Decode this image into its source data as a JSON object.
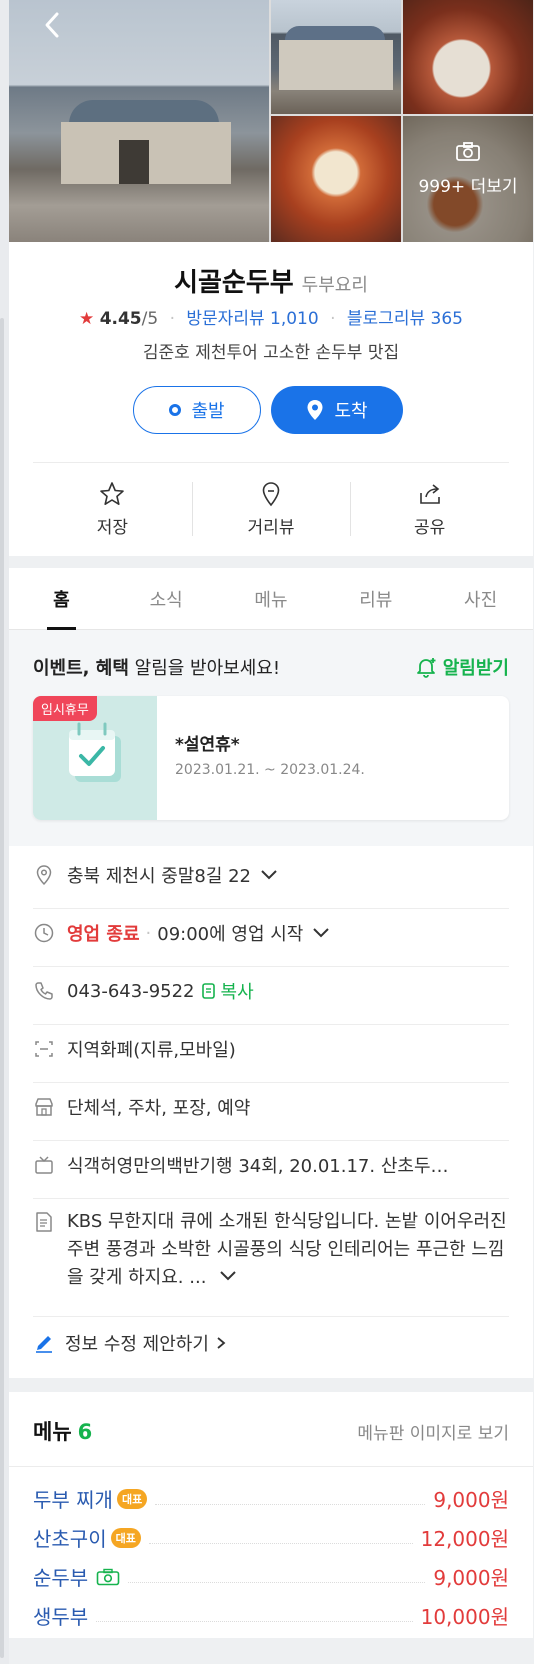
{
  "photos": {
    "more_label": "999+ 더보기",
    "sign_text": "시골순두부"
  },
  "place": {
    "name": "시골순두부",
    "category": "두부요리",
    "rating": "4.45",
    "rating_max": "/5",
    "visitor_review_label": "방문자리뷰 1,010",
    "blog_review_label": "블로그리뷰 365",
    "description": "김준호 제천투어 고소한 손두부 맛집"
  },
  "route": {
    "depart_label": "출발",
    "arrive_label": "도착"
  },
  "actions": {
    "save": "저장",
    "street_view": "거리뷰",
    "share": "공유"
  },
  "tabs": [
    "홈",
    "소식",
    "메뉴",
    "리뷰",
    "사진"
  ],
  "notice": {
    "bold": "이벤트, 혜택",
    "text": " 알림을 받아보세요!",
    "button": "알림받기",
    "event": {
      "badge": "임시휴무",
      "title": "*설연휴*",
      "date": "2023.01.21. ~ 2023.01.24."
    }
  },
  "info": {
    "address": "충북 제천시 중말8길 22",
    "status": "영업 종료",
    "hours": "09:00에 영업 시작",
    "phone": "043-643-9522",
    "copy": "복사",
    "payment": "지역화폐(지류,모바일)",
    "amenities": "단체석, 주차, 포장, 예약",
    "tv": "식객허영만의백반기행 34회, 20.01.17. 산초두…",
    "description": "KBS 무한지대 큐에 소개된 한식당입니다. 논밭 이어우러진 주변 풍경과 소박한 시골풍의 식당 인테리어는 푸근한 느낌을 갖게 하지요. ...",
    "edit": "정보 수정 제안하기"
  },
  "menu": {
    "title": "메뉴",
    "count": "6",
    "view_board": "메뉴판 이미지로 보기",
    "items": [
      {
        "name": "두부 찌개",
        "badge": "대표",
        "price": "9,000원"
      },
      {
        "name": "산초구이",
        "badge": "대표",
        "price": "12,000원"
      },
      {
        "name": "순두부",
        "badge": "",
        "price": "9,000원"
      },
      {
        "name": "생두부",
        "badge": "",
        "price": "10,000원"
      }
    ]
  },
  "colors": {
    "accent_blue": "#1a73e8",
    "green": "#16b34e",
    "red": "#e23b3b",
    "badge_orange": "#f5a623"
  }
}
